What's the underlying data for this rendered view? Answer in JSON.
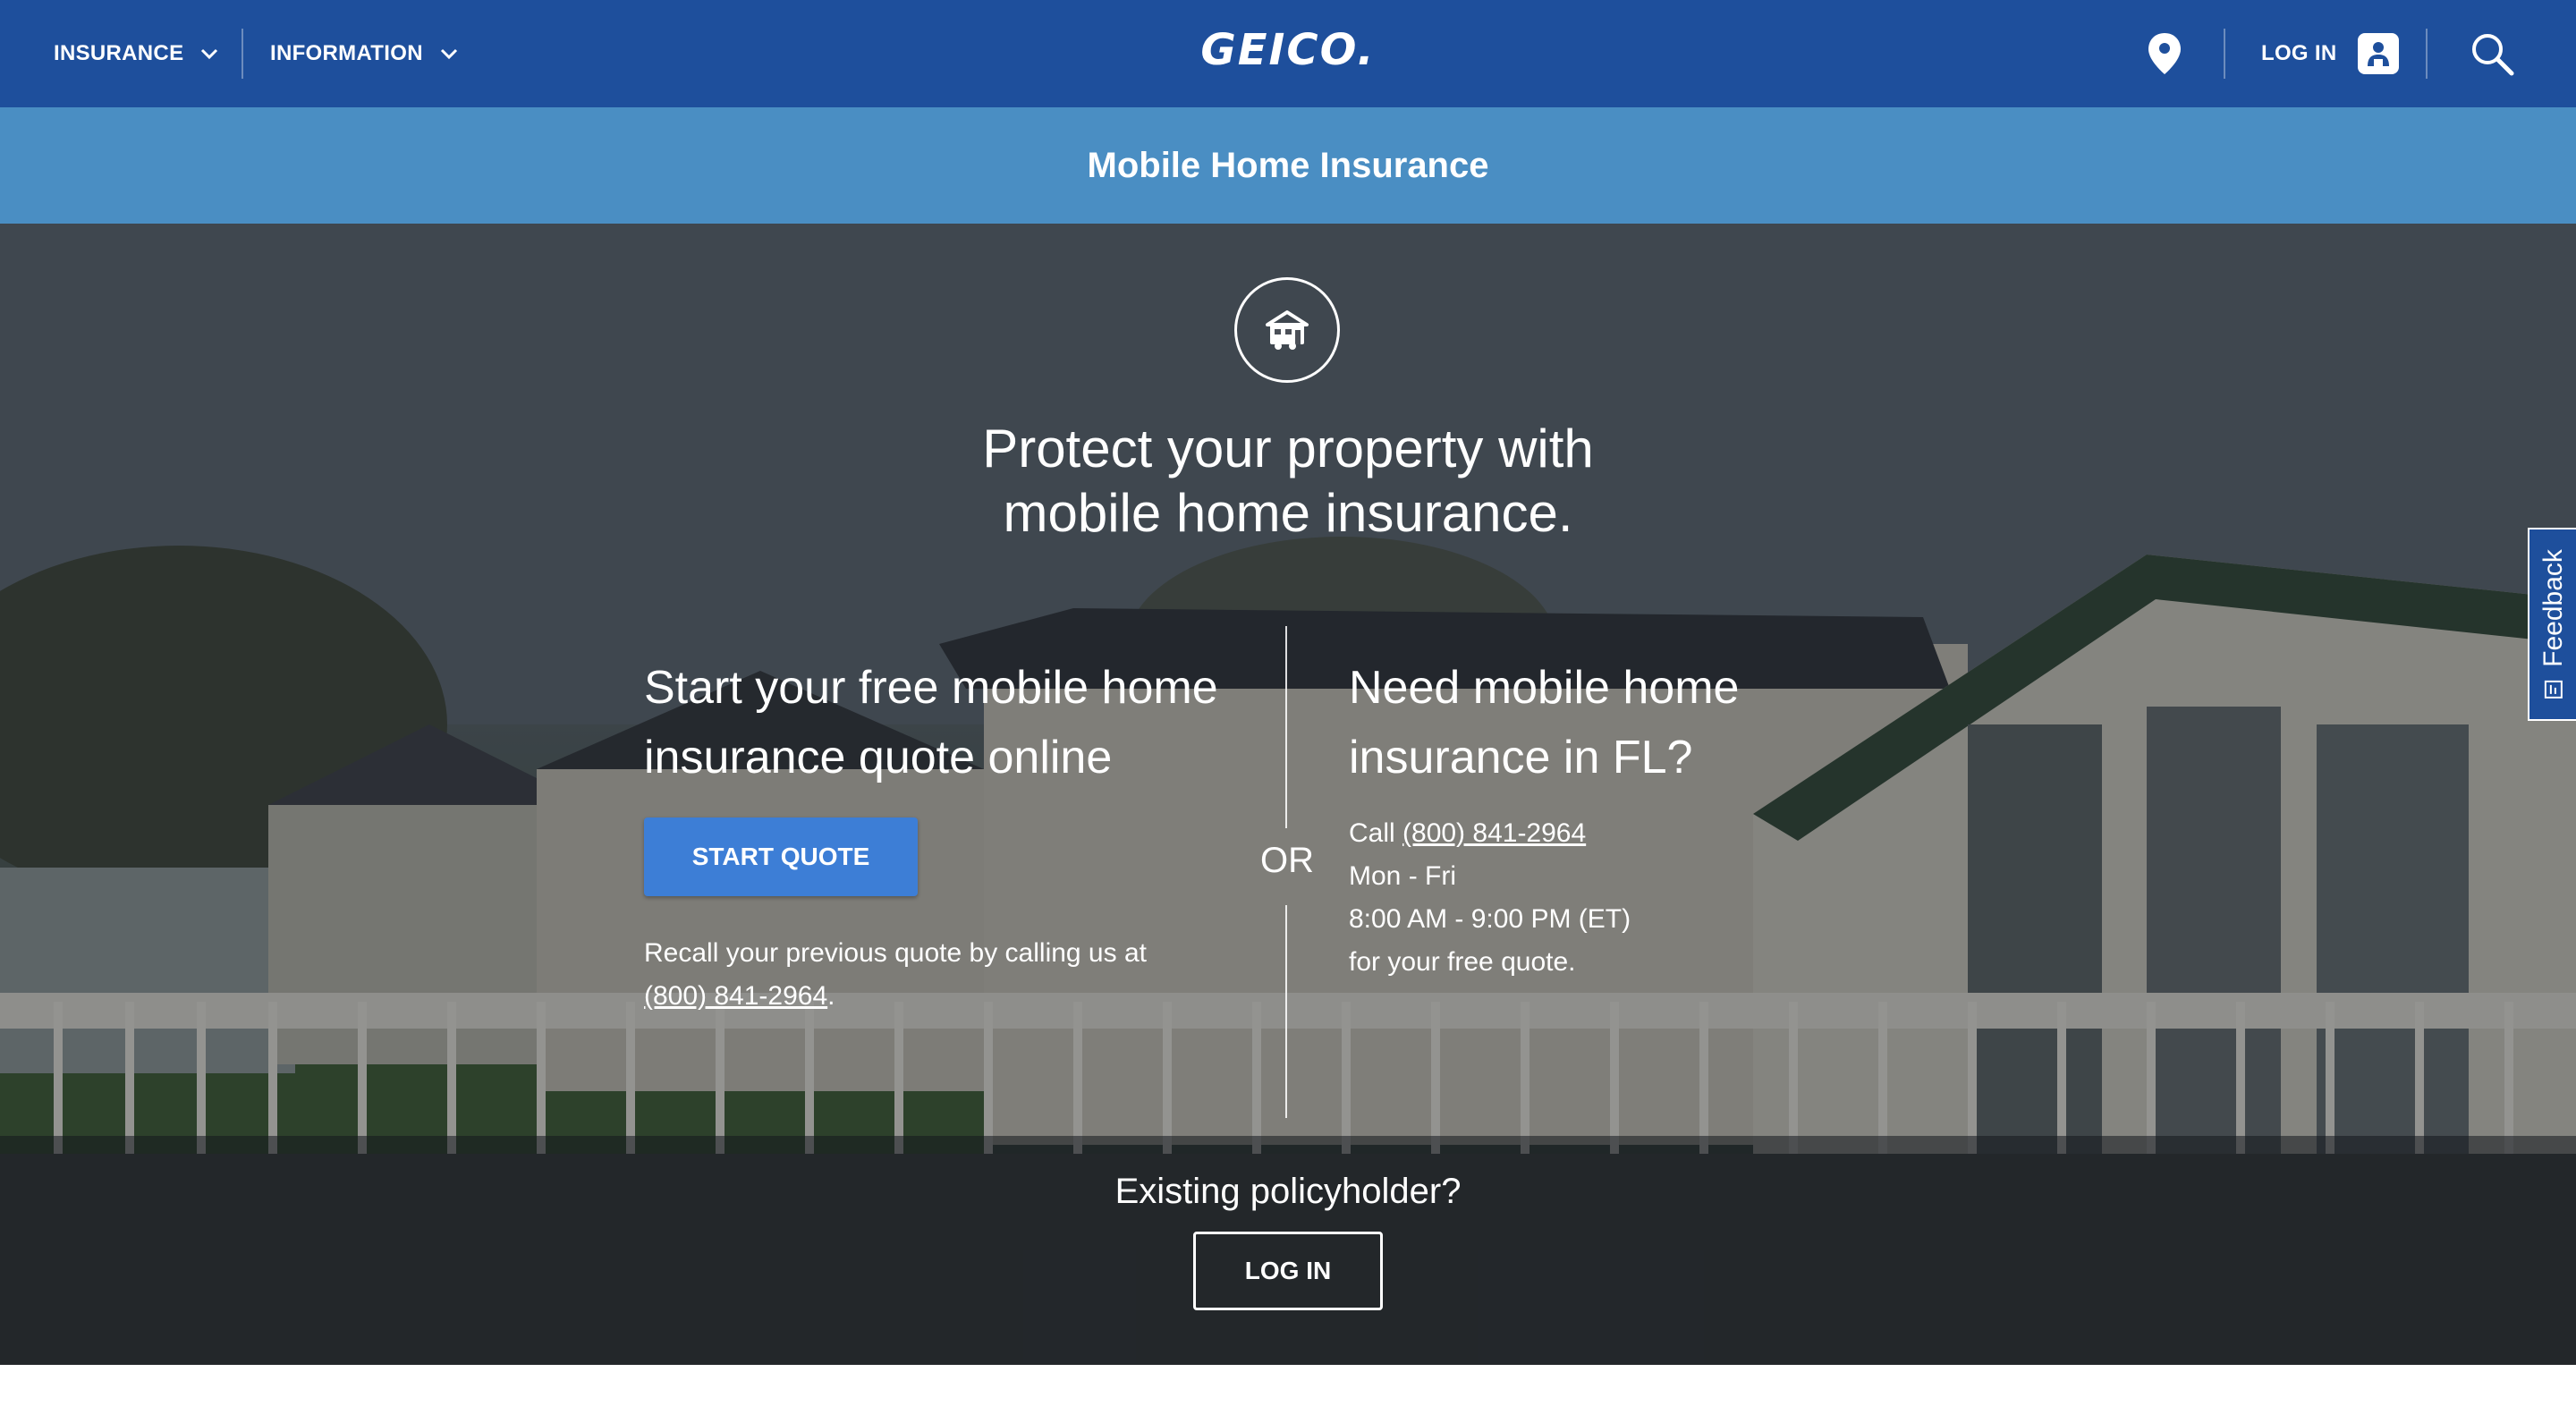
{
  "nav": {
    "insurance_label": "INSURANCE",
    "information_label": "INFORMATION",
    "logo_text": "GEICO.",
    "login_label": "LOG IN",
    "icons": [
      "chevron-down-icon",
      "location-pin-icon",
      "user-icon",
      "search-icon"
    ]
  },
  "subheader": {
    "title": "Mobile Home Insurance"
  },
  "hero": {
    "icon": "mobile-home-icon",
    "headline_line1": "Protect your property with",
    "headline_line2": "mobile home insurance.",
    "left": {
      "title_line1": "Start your free mobile home",
      "title_line2": "insurance quote online",
      "button_label": "START QUOTE",
      "recall_text": "Recall your previous quote by calling us at",
      "recall_phone": "(800) 841-2964",
      "recall_suffix": "."
    },
    "or_label": "OR",
    "right": {
      "title_line1": "Need mobile home",
      "title_line2": "insurance in FL?",
      "call_prefix": "Call ",
      "phone": "(800) 841-2964",
      "days": "Mon - Fri",
      "hours": "8:00 AM - 9:00 PM (ET)",
      "suffix": "for your free quote."
    }
  },
  "policyholder": {
    "question": "Existing policyholder?",
    "button_label": "LOG IN"
  },
  "feedback": {
    "label": "Feedback"
  },
  "colors": {
    "nav_bg": "#1e4f9c",
    "subheader_bg": "#4a8ec3",
    "button_blue": "#3d7ed6"
  }
}
